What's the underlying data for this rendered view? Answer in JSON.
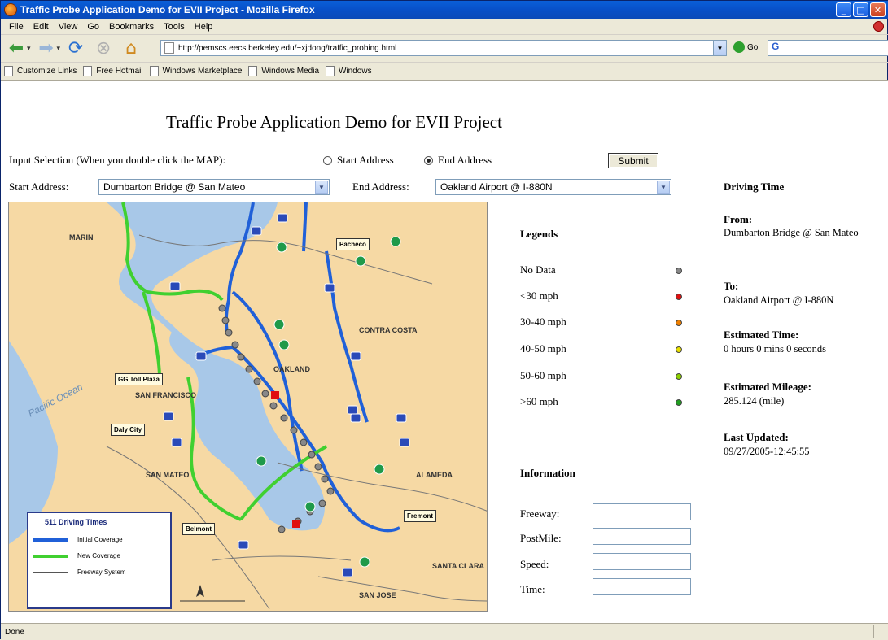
{
  "window": {
    "title": "Traffic Probe Application Demo for EVII Project - Mozilla Firefox"
  },
  "menu": [
    "File",
    "Edit",
    "View",
    "Go",
    "Bookmarks",
    "Tools",
    "Help"
  ],
  "nav": {
    "url": "http://pemscs.eecs.berkeley.edu/~xjdong/traffic_probing.html",
    "go_label": "Go",
    "search_value": "G"
  },
  "bookmarks": [
    "Customize Links",
    "Free Hotmail",
    "Windows Marketplace",
    "Windows Media",
    "Windows"
  ],
  "page": {
    "heading": "Traffic Probe Application Demo for EVII Project",
    "input_selection_label": "Input Selection (When you double click the MAP):",
    "radio_start": "Start Address",
    "radio_end": "End Address",
    "selected_radio": "End Address",
    "submit_label": "Submit",
    "start_address_label": "Start Address:",
    "start_address_value": "Dumbarton Bridge @ San Mateo",
    "end_address_label": "End Address:",
    "end_address_value": "Oakland Airport @ I-880N"
  },
  "map": {
    "labels": {
      "marin": "MARIN",
      "contra_costa": "CONTRA COSTA",
      "san_francisco": "SAN FRANCISCO",
      "san_mateo": "SAN MATEO",
      "alameda": "ALAMEDA",
      "santa_clara": "SANTA CLARA",
      "pacific_ocean": "Pacific Ocean",
      "oakland": "OAKLAND",
      "san_jose": "SAN JOSE"
    },
    "callouts": {
      "pacheco": "Pacheco",
      "gg_toll_plaza": "GG Toll Plaza",
      "daly_city": "Daly City",
      "belmont": "Belmont",
      "fremont": "Fremont"
    },
    "legend": {
      "title": "511 Driving Times",
      "initial": "Initial Coverage",
      "new": "New Coverage",
      "freeway": "Freeway System"
    }
  },
  "legends": {
    "title": "Legends",
    "items": [
      {
        "label": "No Data",
        "color": "#888888"
      },
      {
        "label": "<30 mph",
        "color": "#e01010"
      },
      {
        "label": "30-40 mph",
        "color": "#f08000"
      },
      {
        "label": "40-50 mph",
        "color": "#e8e000"
      },
      {
        "label": "50-60 mph",
        "color": "#8cd000"
      },
      {
        "label": ">60 mph",
        "color": "#20a020"
      }
    ]
  },
  "information": {
    "title": "Information",
    "fields": [
      "Freeway:",
      "PostMile:",
      "Speed:",
      "Time:"
    ]
  },
  "driving_time": {
    "title": "Driving Time",
    "from_label": "From:",
    "from_value": "Dumbarton Bridge @ San Mateo",
    "to_label": "To:",
    "to_value": "Oakland Airport @ I-880N",
    "est_time_label": "Estimated Time:",
    "est_time_value": "0 hours 0 mins 0 seconds",
    "est_mileage_label": "Estimated Mileage:",
    "est_mileage_value": "285.124 (mile)",
    "last_updated_label": "Last Updated:",
    "last_updated_value": "09/27/2005-12:45:55"
  },
  "status": "Done"
}
